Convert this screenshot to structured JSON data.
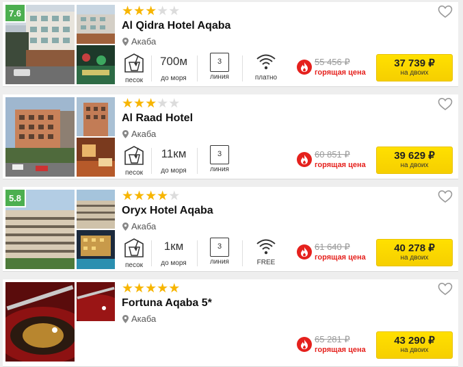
{
  "hotels": [
    {
      "rating": "7.6",
      "stars": 3,
      "name": "Al Qidra Hotel Aqaba",
      "city": "Акаба",
      "beach": "песок",
      "distance": "700м",
      "distance_label": "до моря",
      "line_number": "3",
      "line_label": "линия",
      "wifi": "платно",
      "old_price": "55 456 ₽",
      "hot_label": "горящая цена",
      "price": "37 739 ₽",
      "price_sub": "на двоих"
    },
    {
      "rating": "",
      "stars": 3,
      "name": "Al Raad Hotel",
      "city": "Акаба",
      "beach": "песок",
      "distance": "11км",
      "distance_label": "до моря",
      "line_number": "3",
      "line_label": "линия",
      "wifi": "",
      "old_price": "60 851 ₽",
      "hot_label": "горящая цена",
      "price": "39 629 ₽",
      "price_sub": "на двоих"
    },
    {
      "rating": "5.8",
      "stars": 4,
      "name": "Oryx Hotel Aqaba",
      "city": "Акаба",
      "beach": "песок",
      "distance": "1км",
      "distance_label": "до моря",
      "line_number": "3",
      "line_label": "линия",
      "wifi": "FREE",
      "old_price": "61 640 ₽",
      "hot_label": "горящая цена",
      "price": "40 278 ₽",
      "price_sub": "на двоих"
    },
    {
      "rating": "",
      "stars": 5,
      "name": "Fortuna Aqaba 5*",
      "city": "Акаба",
      "beach": "",
      "distance": "",
      "distance_label": "",
      "line_number": "",
      "line_label": "",
      "wifi": "",
      "old_price": "65 281 ₽",
      "hot_label": "горящая цена",
      "price": "43 290 ₽",
      "price_sub": "на двоих"
    }
  ],
  "icons": {
    "favorite": "heart-outline-icon",
    "location": "map-pin-icon",
    "beach": "sand-bucket-icon",
    "wifi": "wifi-icon",
    "hot": "fire-icon"
  },
  "colors": {
    "rating_badge": "#4caf50",
    "star_on": "#f7b500",
    "star_off": "#dcdcdc",
    "hot": "#e5211d",
    "button": "#ffdd00"
  }
}
